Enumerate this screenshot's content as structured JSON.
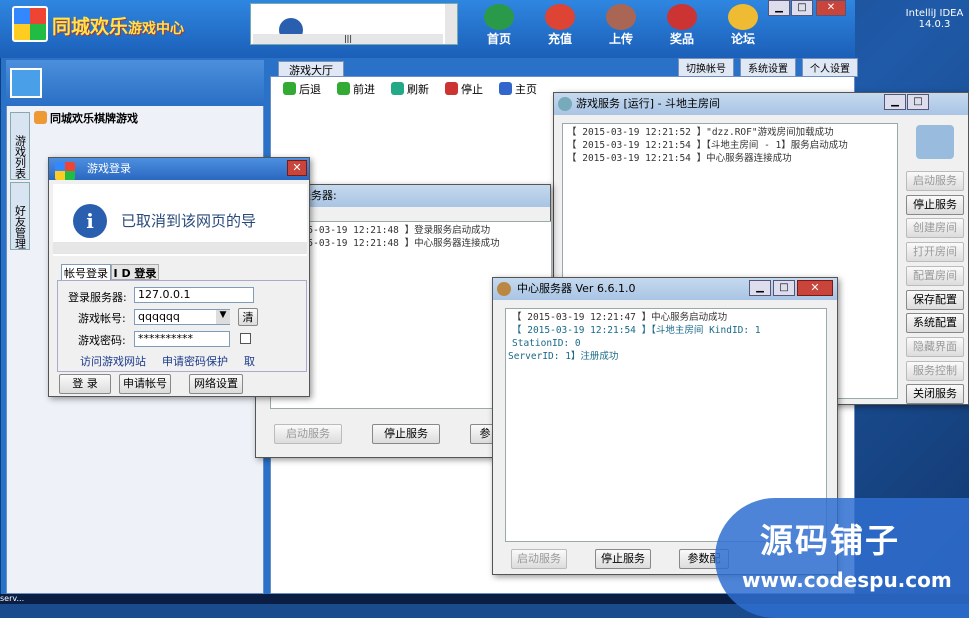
{
  "app": {
    "logo_text": "同城欢乐",
    "logo_sub": "游戏中心"
  },
  "nav": [
    {
      "label": "首页",
      "icon": "globe-icon"
    },
    {
      "label": "充值",
      "icon": "money-bag-icon"
    },
    {
      "label": "上传",
      "icon": "photo-icon"
    },
    {
      "label": "奖品",
      "icon": "gift-icon"
    },
    {
      "label": "论坛",
      "icon": "pencil-icon"
    }
  ],
  "address_bar_text": "|||",
  "right_tabs": [
    "切换帐号",
    "系统设置",
    "个人设置"
  ],
  "hall_tab": "游戏大厅",
  "toolbar": [
    "后退",
    "前进",
    "刷新",
    "停止",
    "主页"
  ],
  "side_tabs": [
    "游戏列表",
    "好友管理"
  ],
  "tree_root": "同城欢乐棋牌游戏",
  "desktop_icon": {
    "line1": "IntelliJ IDEA",
    "line2": "14.0.3"
  },
  "taskbar_text": "serv...",
  "login": {
    "title": "游戏登录",
    "message": "已取消到该网页的导",
    "tabs": [
      "帐号登录",
      "I D 登录"
    ],
    "server_label": "登录服务器:",
    "server_value": "127.0.0.1",
    "account_label": "游戏帐号:",
    "account_value": "qqqqqq",
    "account_side": "清",
    "password_label": "游戏密码:",
    "password_value": "**********",
    "links": [
      "访问游戏网站",
      "申请密码保护",
      "取"
    ],
    "buttons": [
      "登 录",
      "申请帐号",
      "网络设置"
    ]
  },
  "login_server": {
    "title": "登录服务器:",
    "log": [
      "【 2015-03-19 12:21:48 】登录服务启动成功",
      "【 2015-03-19 12:21:48 】中心服务器连接成功"
    ],
    "buttons": [
      "启动服务",
      "停止服务",
      "参"
    ]
  },
  "game_service": {
    "title": "游戏服务 [运行] - 斗地主房间",
    "log": [
      "【 2015-03-19 12:21:52 】\"dzz.ROF\"游戏房间加载成功",
      "【 2015-03-19 12:21:54 】【斗地主房间 - 1】服务启动成功",
      "【 2015-03-19 12:21:54 】中心服务器连接成功"
    ],
    "buttons": [
      "启动服务",
      "停止服务",
      "创建房间",
      "打开房间",
      "配置房间",
      "保存配置",
      "系统配置",
      "隐藏界面",
      "服务控制",
      "关闭服务"
    ],
    "enabled": [
      false,
      true,
      false,
      false,
      false,
      true,
      true,
      false,
      false,
      true
    ]
  },
  "center_server": {
    "title": "中心服务器 Ver 6.6.1.0",
    "log": [
      "【 2015-03-19 12:21:47 】中心服务启动成功",
      "【 2015-03-19 12:21:54 】【斗地主房间   KindID: 1 StationID: 0",
      "ServerID: 1】注册成功"
    ],
    "buttons": [
      "启动服务",
      "停止服务",
      "参数配"
    ]
  },
  "watermark": {
    "line1": "源码铺子",
    "line2": "www.codespu.com"
  }
}
